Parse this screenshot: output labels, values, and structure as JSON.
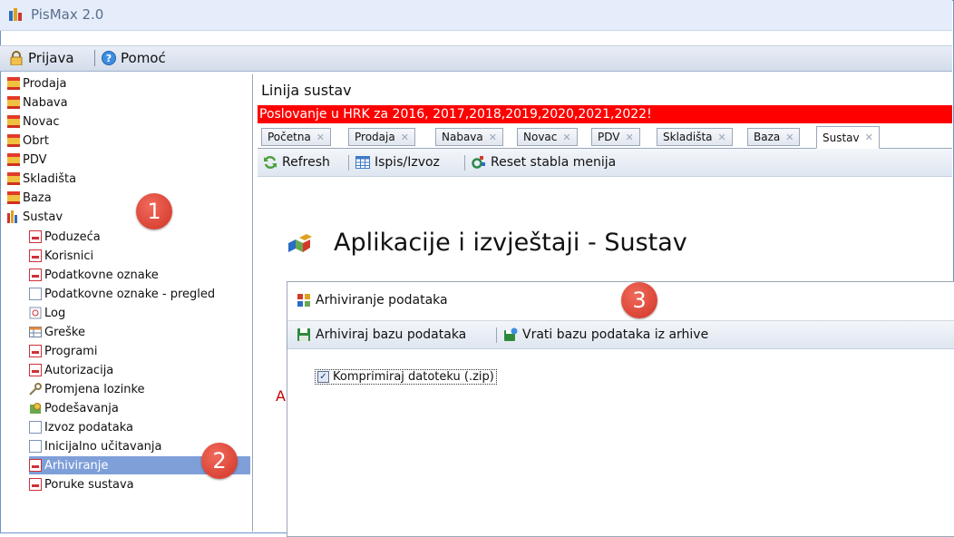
{
  "window": {
    "title": "PisMax 2.0"
  },
  "menubar": {
    "login": "Prijava",
    "help": "Pomoć"
  },
  "tree": {
    "items": [
      {
        "label": "Prodaja"
      },
      {
        "label": "Nabava"
      },
      {
        "label": "Novac"
      },
      {
        "label": "Obrt"
      },
      {
        "label": "PDV"
      },
      {
        "label": "Skladišta"
      },
      {
        "label": "Baza"
      },
      {
        "label": "Sustav"
      }
    ],
    "sustav_children": [
      {
        "label": "Poduzeća"
      },
      {
        "label": "Korisnici"
      },
      {
        "label": "Podatkovne oznake"
      },
      {
        "label": "Podatkovne oznake - pregled"
      },
      {
        "label": "Log"
      },
      {
        "label": "Greške"
      },
      {
        "label": "Programi"
      },
      {
        "label": "Autorizacija"
      },
      {
        "label": "Promjena lozinke"
      },
      {
        "label": "Podešavanja"
      },
      {
        "label": "Izvoz podataka"
      },
      {
        "label": "Inicijalno učitavanja"
      },
      {
        "label": "Arhiviranje"
      },
      {
        "label": "Poruke sustava"
      }
    ],
    "selected": "Arhiviranje"
  },
  "badges": {
    "one": "1",
    "two": "2",
    "three": "3"
  },
  "panel": {
    "title": "Linija sustav",
    "notice": "Poslovanje u HRK za 2016, 2017,2018,2019,2020,2021,2022!",
    "tabs": [
      {
        "label": "Početna"
      },
      {
        "label": "Prodaja"
      },
      {
        "label": "Nabava"
      },
      {
        "label": "Novac"
      },
      {
        "label": "PDV"
      },
      {
        "label": "Skladišta"
      },
      {
        "label": "Baza"
      },
      {
        "label": "Sustav"
      }
    ],
    "active_tab": "Sustav",
    "toolbar": {
      "refresh": "Refresh",
      "print": "Ispis/Izvoz",
      "reset": "Reset stabla menija"
    },
    "heading": "Aplikacije i izvještaji - Sustav",
    "background_letter": "A"
  },
  "dialog": {
    "title": "Arhiviranje podataka",
    "archive_button": "Arhiviraj bazu podataka",
    "restore_button": "Vrati bazu podataka iz arhive",
    "compress_label": "Komprimiraj datoteku (.zip)",
    "compress_checked": true
  },
  "colors": {
    "notice_bg": "#ff0000",
    "badge": "#e04535",
    "selection": "#7f9fd9"
  }
}
